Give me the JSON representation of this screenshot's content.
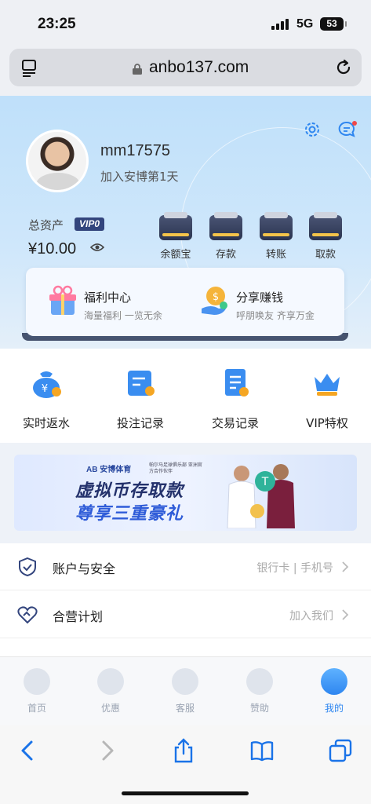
{
  "status_bar": {
    "time": "23:25",
    "network": "5G",
    "battery": "53"
  },
  "browser": {
    "url": "anbo137.com"
  },
  "profile": {
    "username": "mm17575",
    "join_text": "加入安博第1天",
    "assets_label": "总资产",
    "vip_label": "VIP0",
    "balance": "¥10.00"
  },
  "wallet_actions": [
    {
      "label": "余额宝"
    },
    {
      "label": "存款"
    },
    {
      "label": "转账"
    },
    {
      "label": "取款"
    }
  ],
  "promos": [
    {
      "title": "福利中心",
      "subtitle": "海量福利 一览无余"
    },
    {
      "title": "分享赚钱",
      "subtitle": "呼朋唤友 齐享万金"
    }
  ],
  "quick_actions": [
    {
      "label": "实时返水"
    },
    {
      "label": "投注记录"
    },
    {
      "label": "交易记录"
    },
    {
      "label": "VIP特权"
    }
  ],
  "banner": {
    "logo": "AB 安博体育",
    "partner": "帕尔马足球俱乐部 亚洲官方合作伙伴",
    "title": "虚拟币存取款",
    "subtitle": "尊享三重豪礼"
  },
  "settings_list": [
    {
      "title": "账户与安全",
      "value": "银行卡 | 手机号"
    },
    {
      "title": "合营计划",
      "value": "加入我们"
    }
  ],
  "tabs": [
    {
      "label": "首页"
    },
    {
      "label": "优惠"
    },
    {
      "label": "客服"
    },
    {
      "label": "赞助"
    },
    {
      "label": "我的"
    }
  ],
  "colors": {
    "accent": "#2e86f0",
    "header_bg": "#c6e3fb",
    "vip_badge": "#33457d"
  }
}
